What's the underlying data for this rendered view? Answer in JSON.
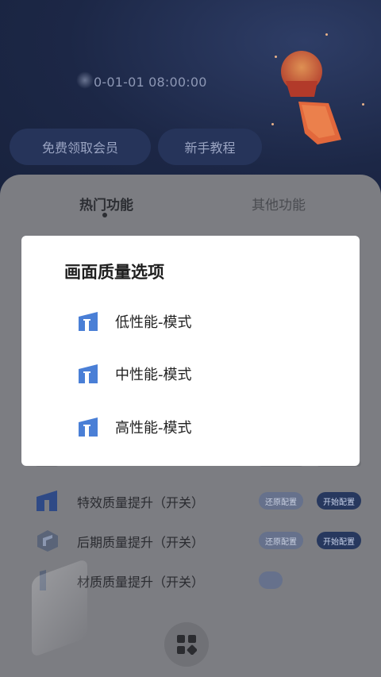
{
  "header": {
    "datetime": "0-01-01 08:00:00",
    "buttons": [
      {
        "label": "免费领取会员"
      },
      {
        "label": "新手教程"
      }
    ]
  },
  "tabs": [
    {
      "label": "热门功能",
      "active": true
    },
    {
      "label": "其他功能",
      "active": false
    }
  ],
  "feature_rows": [
    {
      "label": "特效质量提升（开关）",
      "restore": "还原配置",
      "start": "开始配置"
    },
    {
      "label": "后期质量提升（开关）",
      "restore": "还原配置",
      "start": "开始配置"
    },
    {
      "label": "材质质量提升（开关）"
    }
  ],
  "dialog": {
    "title": "画面质量选项",
    "options": [
      {
        "label": "低性能-模式"
      },
      {
        "label": "中性能-模式"
      },
      {
        "label": "高性能-模式"
      }
    ]
  },
  "colors": {
    "header_bg": "#1c2746",
    "accent_blue": "#4a7fd6",
    "sheet_dimmed": "#7c7d82"
  },
  "icons": {
    "option_icon": "house-icon",
    "fab_icon": "grid-icon"
  }
}
